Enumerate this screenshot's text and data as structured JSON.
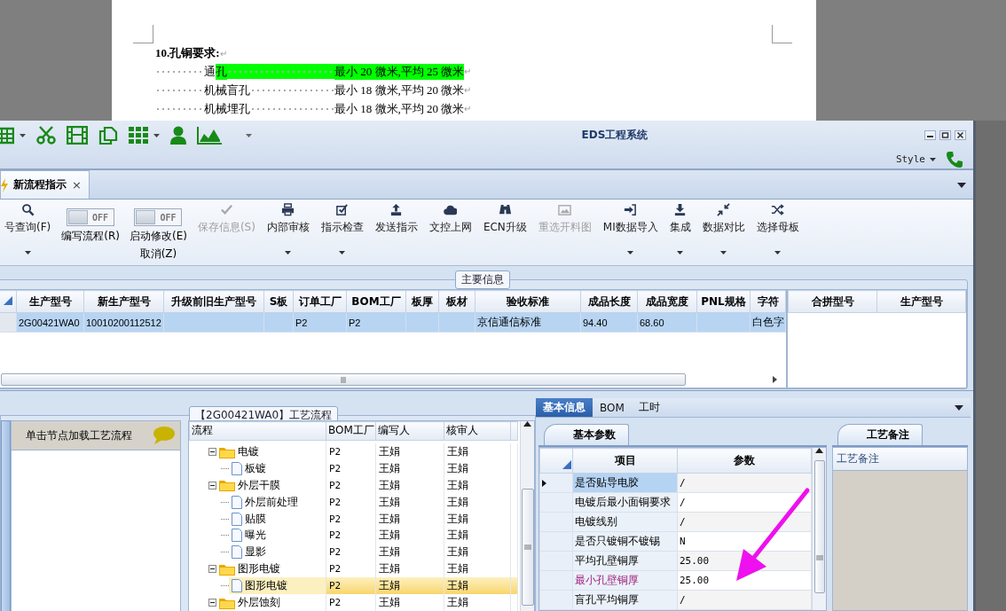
{
  "document": {
    "heading": "10.孔铜要求:",
    "heading_mark": "↵",
    "lines": [
      {
        "label_parts": [
          {
            "text": "通",
            "highlighted": false
          },
          {
            "text": "孔",
            "highlighted": true
          }
        ],
        "leader_highlighted": true,
        "value": "最小 20 微米,平均 25 微米",
        "value_highlighted": true,
        "mark": "↵"
      },
      {
        "label_parts": [
          {
            "text": "机械盲孔",
            "highlighted": false
          }
        ],
        "leader_highlighted": false,
        "value": "最小 18 微米,平均 20 微米",
        "value_highlighted": false,
        "mark": "↵"
      },
      {
        "label_parts": [
          {
            "text": "机械埋孔",
            "highlighted": false
          }
        ],
        "leader_highlighted": false,
        "value": "最小 18 微米,平均 20 微米",
        "value_highlighted": false,
        "mark": "↵"
      }
    ]
  },
  "window": {
    "title": "EDS工程系统",
    "style_menu": "Style"
  },
  "tabs": [
    {
      "label": "新流程指示",
      "selected": true,
      "close": "×"
    }
  ],
  "ribbon": [
    {
      "kind": "button",
      "label": "号查询(F)",
      "disabled": false,
      "dropdown": true
    },
    {
      "kind": "toggle",
      "label": "编写流程(R)",
      "state_text": "OFF",
      "on": false
    },
    {
      "kind": "toggle",
      "label": "启动修改(E)",
      "sublabel": "取消(Z)",
      "state_text": "OFF",
      "on": false
    },
    {
      "kind": "button",
      "label": "保存信息(S)",
      "disabled": true,
      "dropdown": false
    },
    {
      "kind": "button",
      "label": "内部审核",
      "disabled": false,
      "dropdown": true
    },
    {
      "kind": "button",
      "label": "指示检查",
      "disabled": false,
      "dropdown": true
    },
    {
      "kind": "button",
      "label": "发送指示",
      "disabled": false,
      "dropdown": false
    },
    {
      "kind": "button",
      "label": "文控上网",
      "disabled": false,
      "dropdown": false
    },
    {
      "kind": "button",
      "label": "ECN升级",
      "disabled": false,
      "dropdown": false
    },
    {
      "kind": "button",
      "label": "重选开料图",
      "disabled": true,
      "dropdown": false
    },
    {
      "kind": "button",
      "label": "MI数据导入",
      "disabled": false,
      "dropdown": true
    },
    {
      "kind": "button",
      "label": "集成",
      "disabled": false,
      "dropdown": true
    },
    {
      "kind": "button",
      "label": "数据对比",
      "disabled": false,
      "dropdown": true
    },
    {
      "kind": "button",
      "label": "选择母板",
      "disabled": false,
      "dropdown": true
    }
  ],
  "main_info": {
    "legend": "主要信息",
    "columns": [
      "生产型号",
      "新生产型号",
      "升级前旧生产型号",
      "S板",
      "订单工厂",
      "BOM工厂",
      "板厚",
      "板材",
      "验收标准",
      "成品长度",
      "成品宽度",
      "PNL规格",
      "字符"
    ],
    "rows": [
      {
        "selected": true,
        "cells": [
          "2G00421WA0",
          "10010200112512",
          null,
          null,
          "P2",
          "P2",
          null,
          null,
          "京信通信标准",
          "94.40",
          "68.60",
          null,
          "白色字"
        ]
      }
    ],
    "merge_table": {
      "columns": [
        "合拼型号",
        "生产型号"
      ]
    }
  },
  "process": {
    "legend": "【2G00421WA0】工艺流程",
    "hint": "单击节点加载工艺流程",
    "columns": [
      "流程",
      "BOM工厂",
      "编写人",
      "核审人"
    ],
    "tree": [
      {
        "kind": "folder",
        "label": "电镀",
        "factory": "P2",
        "writer": "王娟",
        "reviewer": "王娟",
        "expanded": true,
        "selected": false,
        "children": [
          {
            "kind": "file",
            "label": "板镀",
            "factory": "P2",
            "writer": "王娟",
            "reviewer": "王娟",
            "selected": false
          }
        ]
      },
      {
        "kind": "folder",
        "label": "外层干膜",
        "factory": "P2",
        "writer": "王娟",
        "reviewer": "王娟",
        "expanded": true,
        "selected": false,
        "children": [
          {
            "kind": "file",
            "label": "外层前处理",
            "factory": "P2",
            "writer": "王娟",
            "reviewer": "王娟",
            "selected": false
          },
          {
            "kind": "file",
            "label": "贴膜",
            "factory": "P2",
            "writer": "王娟",
            "reviewer": "王娟",
            "selected": false
          },
          {
            "kind": "file",
            "label": "曝光",
            "factory": "P2",
            "writer": "王娟",
            "reviewer": "王娟",
            "selected": false
          },
          {
            "kind": "file",
            "label": "显影",
            "factory": "P2",
            "writer": "王娟",
            "reviewer": "王娟",
            "selected": false
          }
        ]
      },
      {
        "kind": "folder",
        "label": "图形电镀",
        "factory": "P2",
        "writer": "王娟",
        "reviewer": "王娟",
        "expanded": true,
        "selected": false,
        "children": [
          {
            "kind": "file",
            "label": "图形电镀",
            "factory": "P2",
            "writer": "王娟",
            "reviewer": "王娟",
            "selected": true
          }
        ]
      },
      {
        "kind": "folder",
        "label": "外层蚀刻",
        "factory": "P2",
        "writer": "王娟",
        "reviewer": "王娟",
        "expanded": true,
        "selected": false
      }
    ]
  },
  "details": {
    "tabs": [
      {
        "label": "基本信息",
        "selected": true
      },
      {
        "label": "BOM",
        "selected": false
      },
      {
        "label": "工时",
        "selected": false
      }
    ],
    "params": {
      "tab": "基本参数",
      "columns": [
        "项目",
        "参数"
      ],
      "rows": [
        {
          "item": "是否贴导电胶",
          "value": "/",
          "selected": true,
          "highlighted": false
        },
        {
          "item": "电镀后最小面铜要求",
          "value": "/",
          "selected": false,
          "highlighted": false
        },
        {
          "item": "电镀线别",
          "value": "/",
          "selected": false,
          "highlighted": false
        },
        {
          "item": "是否只镀铜不镀锡",
          "value": "N",
          "selected": false,
          "highlighted": false
        },
        {
          "item": "平均孔壁铜厚",
          "value": "25.00",
          "selected": false,
          "highlighted": false
        },
        {
          "item": "最小孔壁铜厚",
          "value": "25.00",
          "selected": false,
          "highlighted": true
        },
        {
          "item": "盲孔平均铜厚",
          "value": "/",
          "selected": false,
          "highlighted": false
        }
      ]
    },
    "notes": {
      "tab": "工艺备注",
      "header": "工艺备注"
    }
  }
}
